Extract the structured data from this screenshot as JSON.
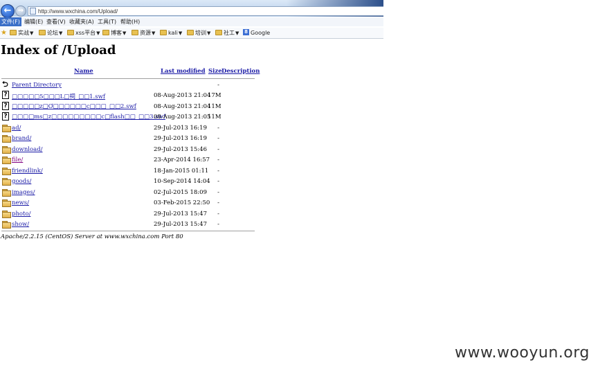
{
  "browser": {
    "url": "http://www.wxchina.com/Upload/",
    "back_label": "←",
    "forward_label": "→",
    "menu": [
      "文件(F)",
      "编辑(E)",
      "查看(V)",
      "收藏夹(A)",
      "工具(T)",
      "帮助(H)"
    ],
    "favorites": [
      "实战",
      "论坛",
      "xss平台",
      "博客",
      "资源",
      "kali",
      "培训",
      "社工",
      "Google"
    ]
  },
  "page": {
    "title": "Index of /Upload",
    "columns": {
      "name": "Name",
      "modified": "Last modified",
      "size": "Size",
      "description": "Description"
    },
    "parent": {
      "label": "Parent Directory",
      "size": "-"
    },
    "entries": [
      {
        "name": "□□□□□5□□□L□祠_□□1.swf",
        "modified": "08-Aug-2013 21:04",
        "size": "17M",
        "type": "file"
      },
      {
        "name": "□□□□□z□Ơ□□□□□□c□□□_□□2.swf",
        "modified": "08-Aug-2013 21:04",
        "size": "11M",
        "type": "file"
      },
      {
        "name": "□□□□ms□z□□□□□□□□□c□flash□□_□□3.swf",
        "modified": "08-Aug-2013 21:05",
        "size": "11M",
        "type": "file"
      },
      {
        "name": "ad/",
        "modified": "29-Jul-2013 16:19",
        "size": "-",
        "type": "folder"
      },
      {
        "name": "brand/",
        "modified": "29-Jul-2013 16:19",
        "size": "-",
        "type": "folder"
      },
      {
        "name": "download/",
        "modified": "29-Jul-2013 15:46",
        "size": "-",
        "type": "folder"
      },
      {
        "name": "file/",
        "modified": "23-Apr-2014 16:57",
        "size": "-",
        "type": "folder"
      },
      {
        "name": "friendlink/",
        "modified": "18-Jan-2015 01:11",
        "size": "-",
        "type": "folder"
      },
      {
        "name": "goods/",
        "modified": "10-Sep-2014 14:04",
        "size": "-",
        "type": "folder"
      },
      {
        "name": "images/",
        "modified": "02-Jul-2015 18:09",
        "size": "-",
        "type": "folder"
      },
      {
        "name": "news/",
        "modified": "03-Feb-2015 22:50",
        "size": "-",
        "type": "folder"
      },
      {
        "name": "photo/",
        "modified": "29-Jul-2013 15:47",
        "size": "-",
        "type": "folder"
      },
      {
        "name": "show/",
        "modified": "29-Jul-2013 15:47",
        "size": "-",
        "type": "folder"
      }
    ],
    "server_signature": "Apache/2.2.15 (CentOS) Server at www.wxchina.com Port 80"
  },
  "watermark": "www.wooyun.org"
}
